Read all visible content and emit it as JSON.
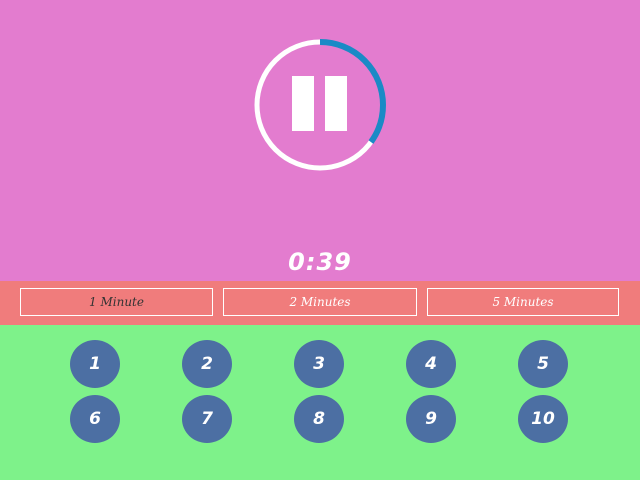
{
  "timer": {
    "remaining": "0:39",
    "progress_fraction": 0.35,
    "progress_color": "#1a8ac6",
    "track_color": "#ffffff",
    "state": "paused-icon"
  },
  "durations": [
    {
      "label": "1 Minute",
      "selected": true
    },
    {
      "label": "2 Minutes",
      "selected": false
    },
    {
      "label": "5 Minutes",
      "selected": false
    }
  ],
  "numbers": [
    "1",
    "2",
    "3",
    "4",
    "5",
    "6",
    "7",
    "8",
    "9",
    "10"
  ],
  "colors": {
    "top_bg": "#e37ccf",
    "strip_bg": "#f07c7c",
    "bottom_bg": "#7ef28a",
    "number_button": "#4c6fa3"
  }
}
